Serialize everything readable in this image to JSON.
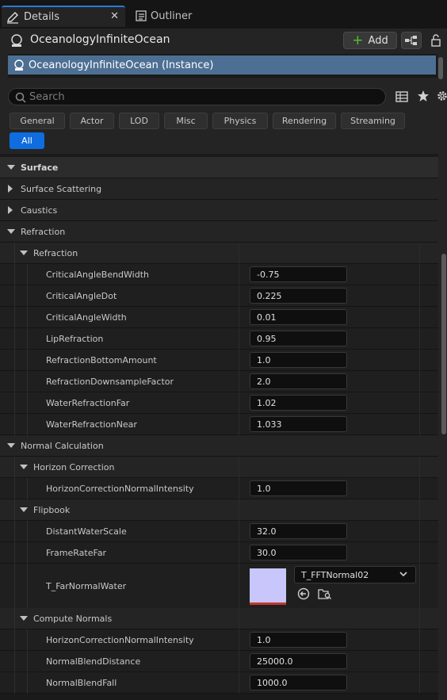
{
  "tabs": [
    {
      "label": "Details",
      "icon": "pencil-icon",
      "active": true
    },
    {
      "label": "Outliner",
      "icon": "outliner-icon",
      "active": false
    }
  ],
  "header": {
    "actor_name": "OceanologyInfiniteOcean",
    "add_label": "Add",
    "component_row": "OceanologyInfiniteOcean (Instance)"
  },
  "search": {
    "placeholder": "Search"
  },
  "filters": [
    "General",
    "Actor",
    "LOD",
    "Misc",
    "Physics",
    "Rendering",
    "Streaming",
    "All"
  ],
  "properties": {
    "surface": "Surface",
    "surface_scattering": "Surface Scattering",
    "caustics": "Caustics",
    "refraction_cat": "Refraction",
    "refraction_sub": "Refraction",
    "refraction_props": [
      {
        "name": "CriticalAngleBendWidth",
        "value": "-0.75"
      },
      {
        "name": "CriticalAngleDot",
        "value": "0.225"
      },
      {
        "name": "CriticalAngleWidth",
        "value": "0.01"
      },
      {
        "name": "LipRefraction",
        "value": "0.95"
      },
      {
        "name": "RefractionBottomAmount",
        "value": "1.0"
      },
      {
        "name": "RefractionDownsampleFactor",
        "value": "2.0"
      },
      {
        "name": "WaterRefractionFar",
        "value": "1.02"
      },
      {
        "name": "WaterRefractionNear",
        "value": "1.033"
      }
    ],
    "normal_calculation": "Normal Calculation",
    "horizon_correction": "Horizon Correction",
    "horizon_props": [
      {
        "name": "HorizonCorrectionNormalIntensity",
        "value": "1.0"
      }
    ],
    "flipbook": "Flipbook",
    "flipbook_props": [
      {
        "name": "DistantWaterScale",
        "value": "32.0"
      },
      {
        "name": "FrameRateFar",
        "value": "30.0"
      }
    ],
    "texture_prop": {
      "name": "T_FarNormalWater",
      "asset": "T_FFTNormal02",
      "swatch_color": "#c8c6fb"
    },
    "compute_normals": "Compute Normals",
    "compute_props": [
      {
        "name": "HorizonCorrectionNormalIntensity",
        "value": "1.0"
      },
      {
        "name": "NormalBlendDistance",
        "value": "25000.0"
      },
      {
        "name": "NormalBlendFall",
        "value": "1000.0"
      }
    ]
  },
  "colors": {
    "accent": "#0f6de0",
    "selection": "#4d6f93",
    "tab_highlight": "#2a7ad6"
  }
}
